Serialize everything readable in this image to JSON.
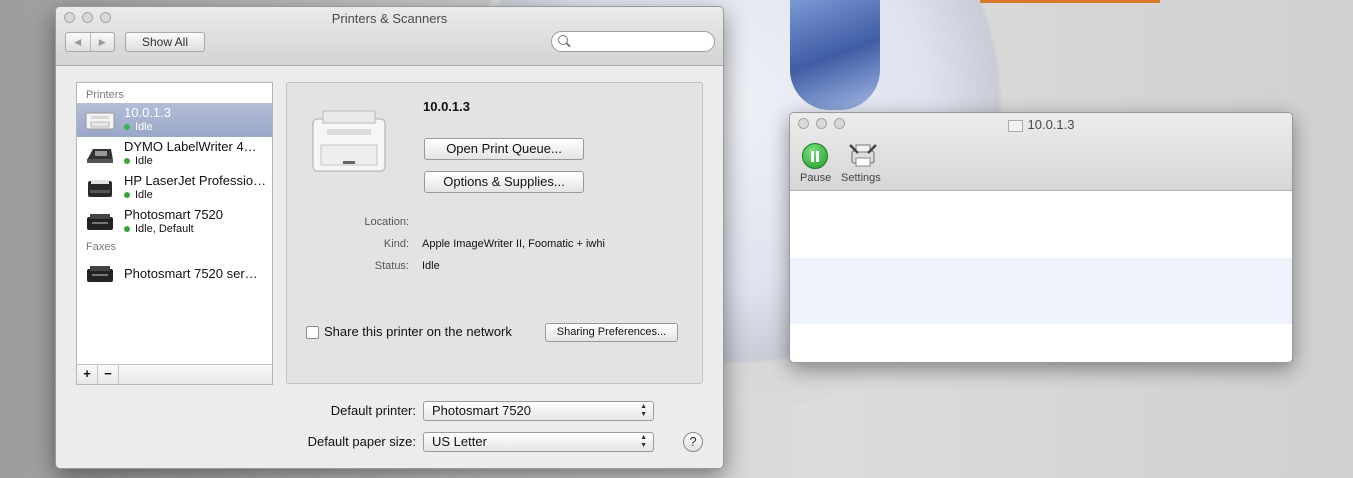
{
  "main_window": {
    "title": "Printers & Scanners",
    "nav_back": "◀",
    "nav_forward": "▶",
    "show_all": "Show All",
    "search_placeholder": ""
  },
  "sidebar": {
    "printers_header": "Printers",
    "faxes_header": "Faxes",
    "printers": [
      {
        "name": "10.0.1.3",
        "status": "Idle",
        "selected": true
      },
      {
        "name": "DYMO LabelWriter 4…",
        "status": "Idle"
      },
      {
        "name": "HP LaserJet Professio…",
        "status": "Idle"
      },
      {
        "name": "Photosmart 7520",
        "status": "Idle, Default"
      }
    ],
    "faxes": [
      {
        "name": "Photosmart 7520 ser…"
      }
    ],
    "add_label": "+",
    "remove_label": "−"
  },
  "detail": {
    "name": "10.0.1.3",
    "open_queue": "Open Print Queue...",
    "options_supplies": "Options & Supplies...",
    "location_label": "Location:",
    "location_value": "",
    "kind_label": "Kind:",
    "kind_value": "Apple ImageWriter II, Foomatic + iwhi",
    "status_label": "Status:",
    "status_value": "Idle",
    "share_label": "Share this printer on the network",
    "share_checked": false,
    "sharing_prefs": "Sharing Preferences..."
  },
  "defaults": {
    "printer_label": "Default printer:",
    "printer_value": "Photosmart 7520",
    "paper_label": "Default paper size:",
    "paper_value": "US Letter",
    "help": "?"
  },
  "queue_window": {
    "title": "10.0.1.3",
    "pause_label": "Pause",
    "settings_label": "Settings"
  }
}
